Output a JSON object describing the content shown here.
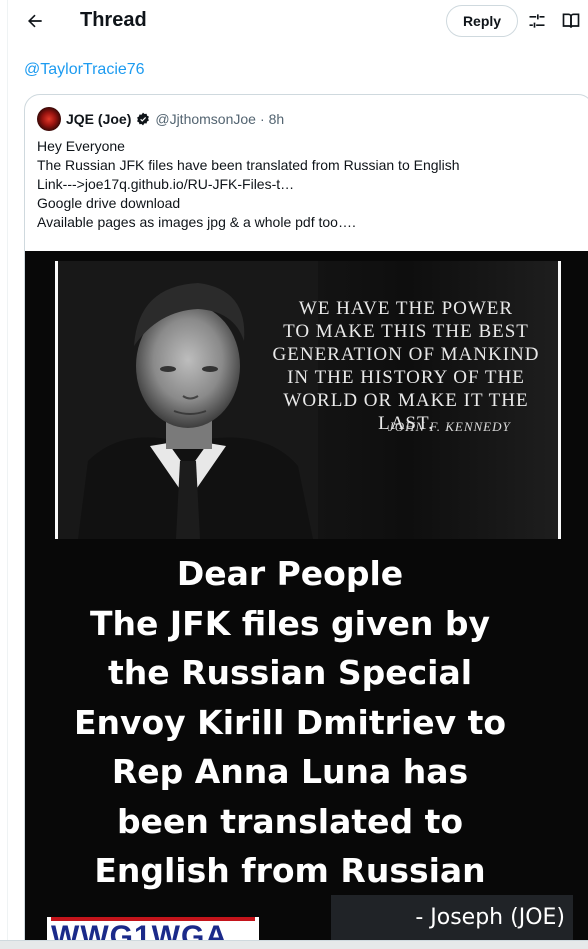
{
  "header": {
    "back_icon": "arrow-left-icon",
    "title": "Thread",
    "reply_label": "Reply",
    "tune_icon": "sliders-icon",
    "reader_icon": "book-open-icon"
  },
  "mention": "@TaylorTracie76",
  "quoted_post": {
    "author_name": "JQE (Joe)",
    "verified_icon": "verified-badge-icon",
    "handle": "@JjthomsonJoe",
    "separator": "·",
    "time": "8h",
    "lines": [
      "Hey Everyone",
      "The Russian JFK files have been translated from Russian to English",
      "Link--->joe17q.github.io/RU-JFK-Files-t…",
      "Google drive download",
      "Available pages as images jpg & a whole pdf too…."
    ]
  },
  "media": {
    "quote_lines": [
      "We have the power",
      "to make this the best",
      "generation of mankind",
      "in the history of the",
      "world or make it the last."
    ],
    "quote_author": "John F. Kennedy",
    "big_lines": [
      "Dear People",
      "The JFK files given by",
      "the Russian Special",
      "Envoy Kirill Dmitriev to",
      "Rep Anna Luna has",
      "been translated to",
      "English from Russian"
    ],
    "logo_text": "WWG1WGA",
    "signature": "- Joseph (JOE)"
  },
  "colors": {
    "accent": "#1d9bf0",
    "text": "#0f1419",
    "muted": "#536471",
    "border": "#cfd9de"
  }
}
